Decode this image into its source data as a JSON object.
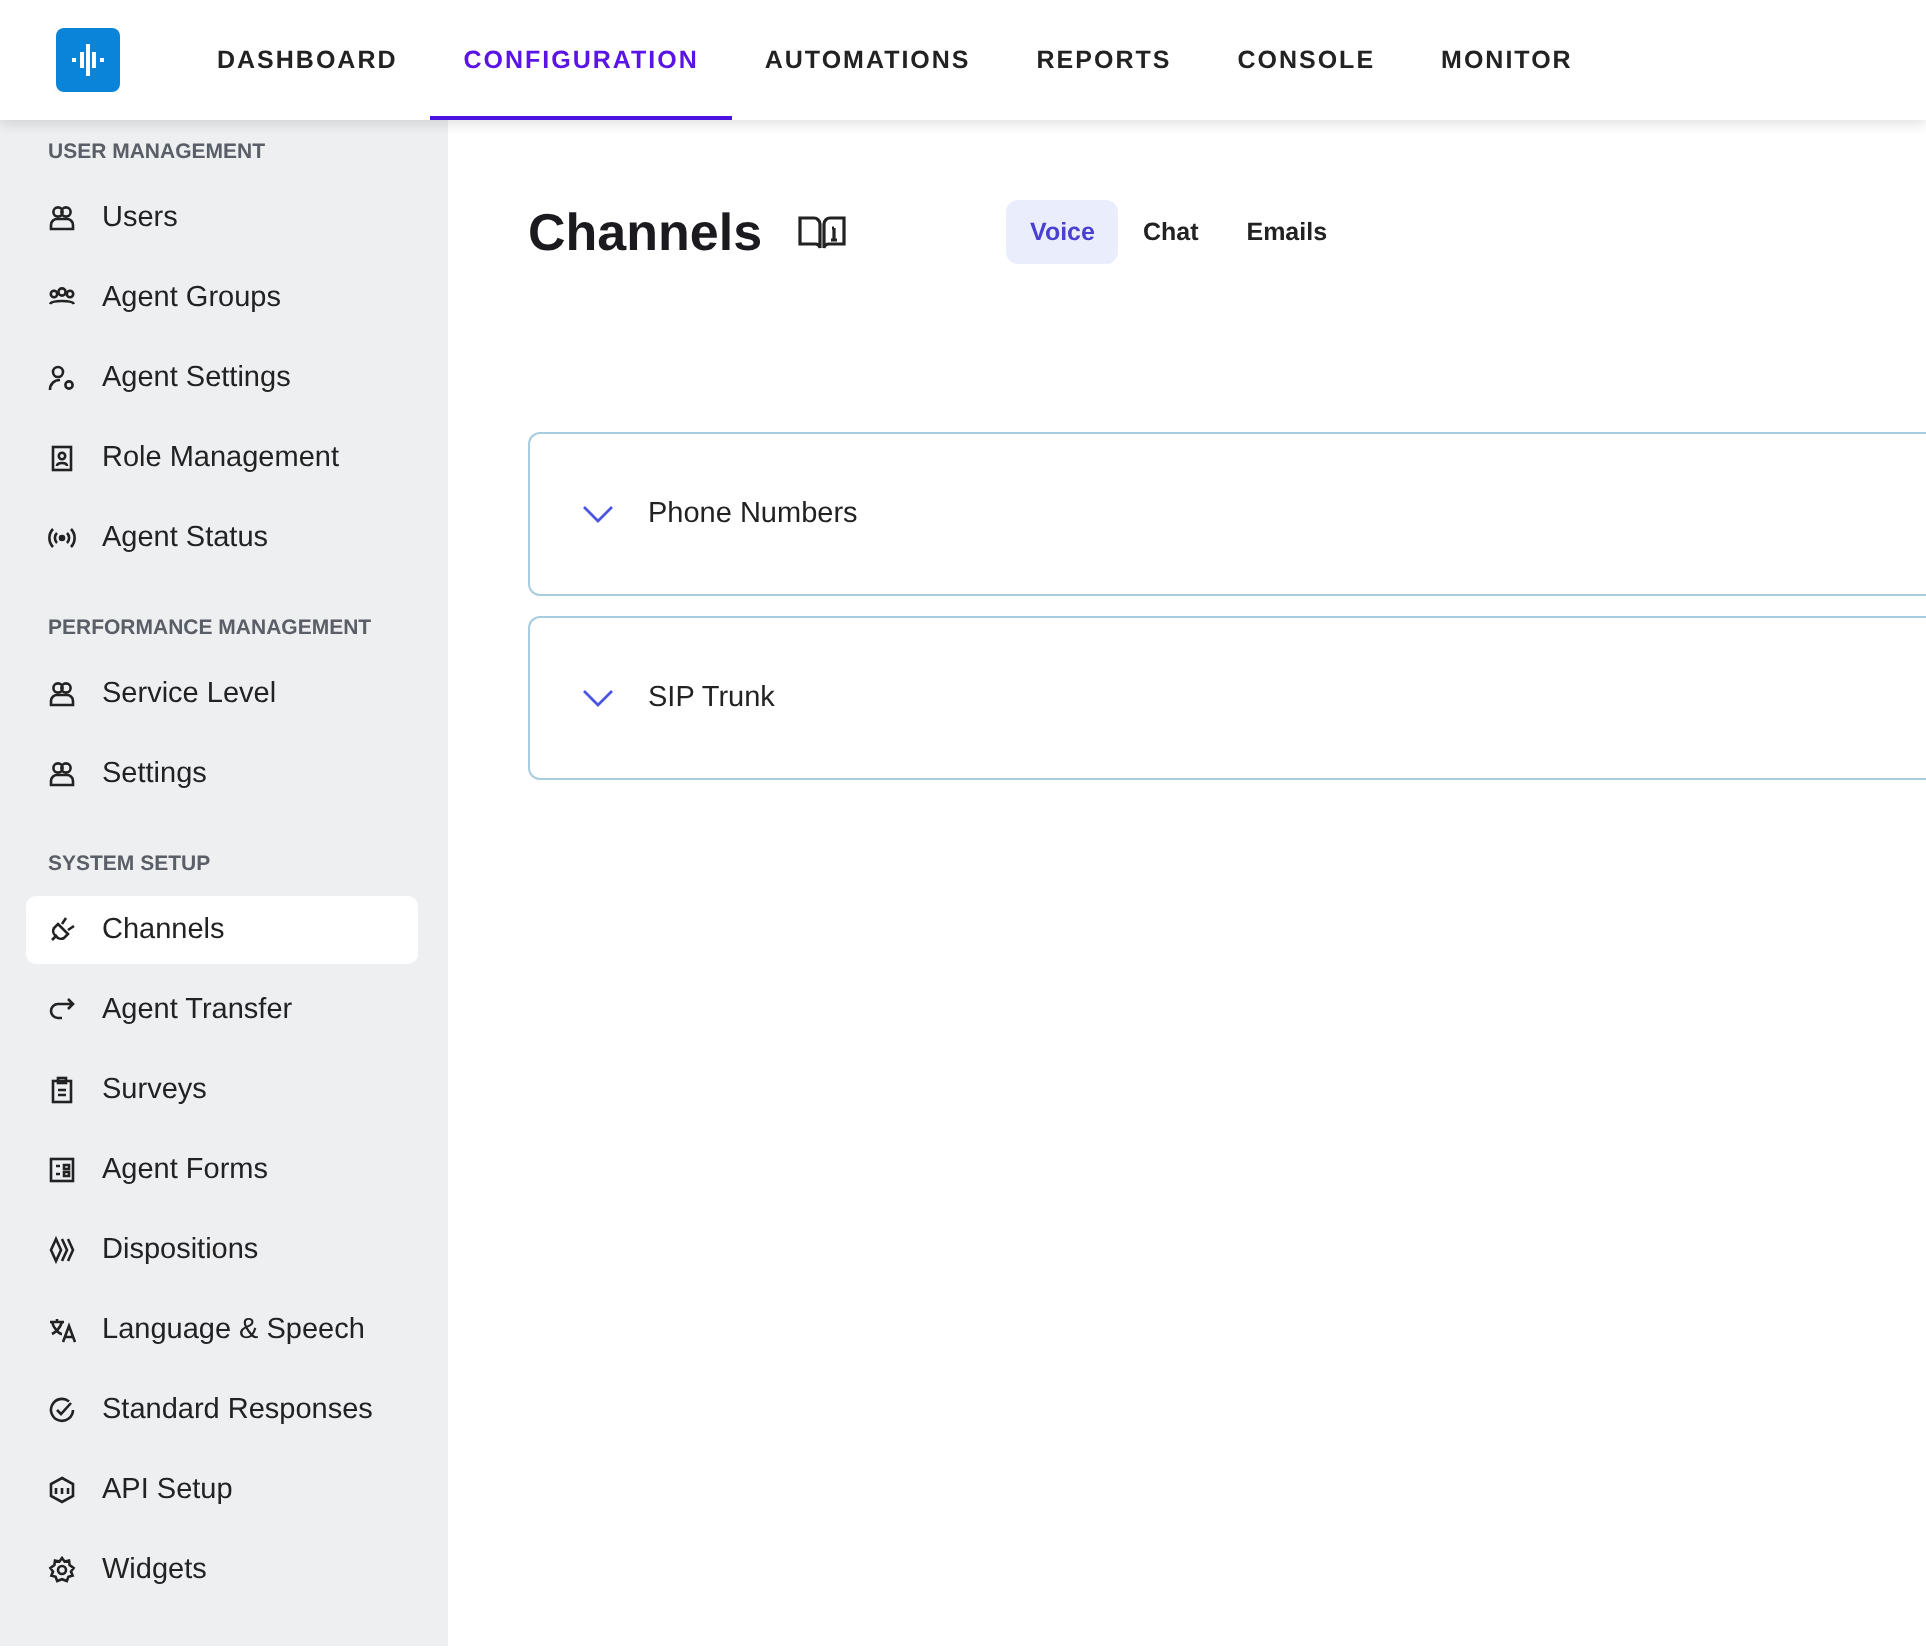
{
  "nav": [
    {
      "label": "DASHBOARD",
      "selected": false
    },
    {
      "label": "CONFIGURATION",
      "selected": true
    },
    {
      "label": "AUTOMATIONS",
      "selected": false
    },
    {
      "label": "REPORTS",
      "selected": false
    },
    {
      "label": "CONSOLE",
      "selected": false
    },
    {
      "label": "MONITOR",
      "selected": false
    }
  ],
  "sidebar": {
    "sections": [
      {
        "title": "USER MANAGEMENT",
        "items": [
          {
            "label": "Users",
            "selected": false
          },
          {
            "label": "Agent Groups",
            "selected": false
          },
          {
            "label": "Agent Settings",
            "selected": false
          },
          {
            "label": "Role Management",
            "selected": false
          },
          {
            "label": "Agent Status",
            "selected": false
          }
        ]
      },
      {
        "title": "PERFORMANCE MANAGEMENT",
        "items": [
          {
            "label": "Service Level",
            "selected": false
          },
          {
            "label": "Settings",
            "selected": false
          }
        ]
      },
      {
        "title": "SYSTEM SETUP",
        "items": [
          {
            "label": "Channels",
            "selected": true
          },
          {
            "label": "Agent Transfer",
            "selected": false
          },
          {
            "label": "Surveys",
            "selected": false
          },
          {
            "label": "Agent Forms",
            "selected": false
          },
          {
            "label": "Dispositions",
            "selected": false
          },
          {
            "label": "Language & Speech",
            "selected": false
          },
          {
            "label": "Standard Responses",
            "selected": false
          },
          {
            "label": "API Setup",
            "selected": false
          },
          {
            "label": "Widgets",
            "selected": false
          }
        ]
      }
    ]
  },
  "page": {
    "title": "Channels",
    "tabs": [
      {
        "label": "Voice",
        "selected": true
      },
      {
        "label": "Chat",
        "selected": false
      },
      {
        "label": "Emails",
        "selected": false
      }
    ],
    "panels": [
      {
        "title": "Phone Numbers",
        "expanded": false
      },
      {
        "title": "SIP Trunk",
        "expanded": false
      }
    ]
  }
}
